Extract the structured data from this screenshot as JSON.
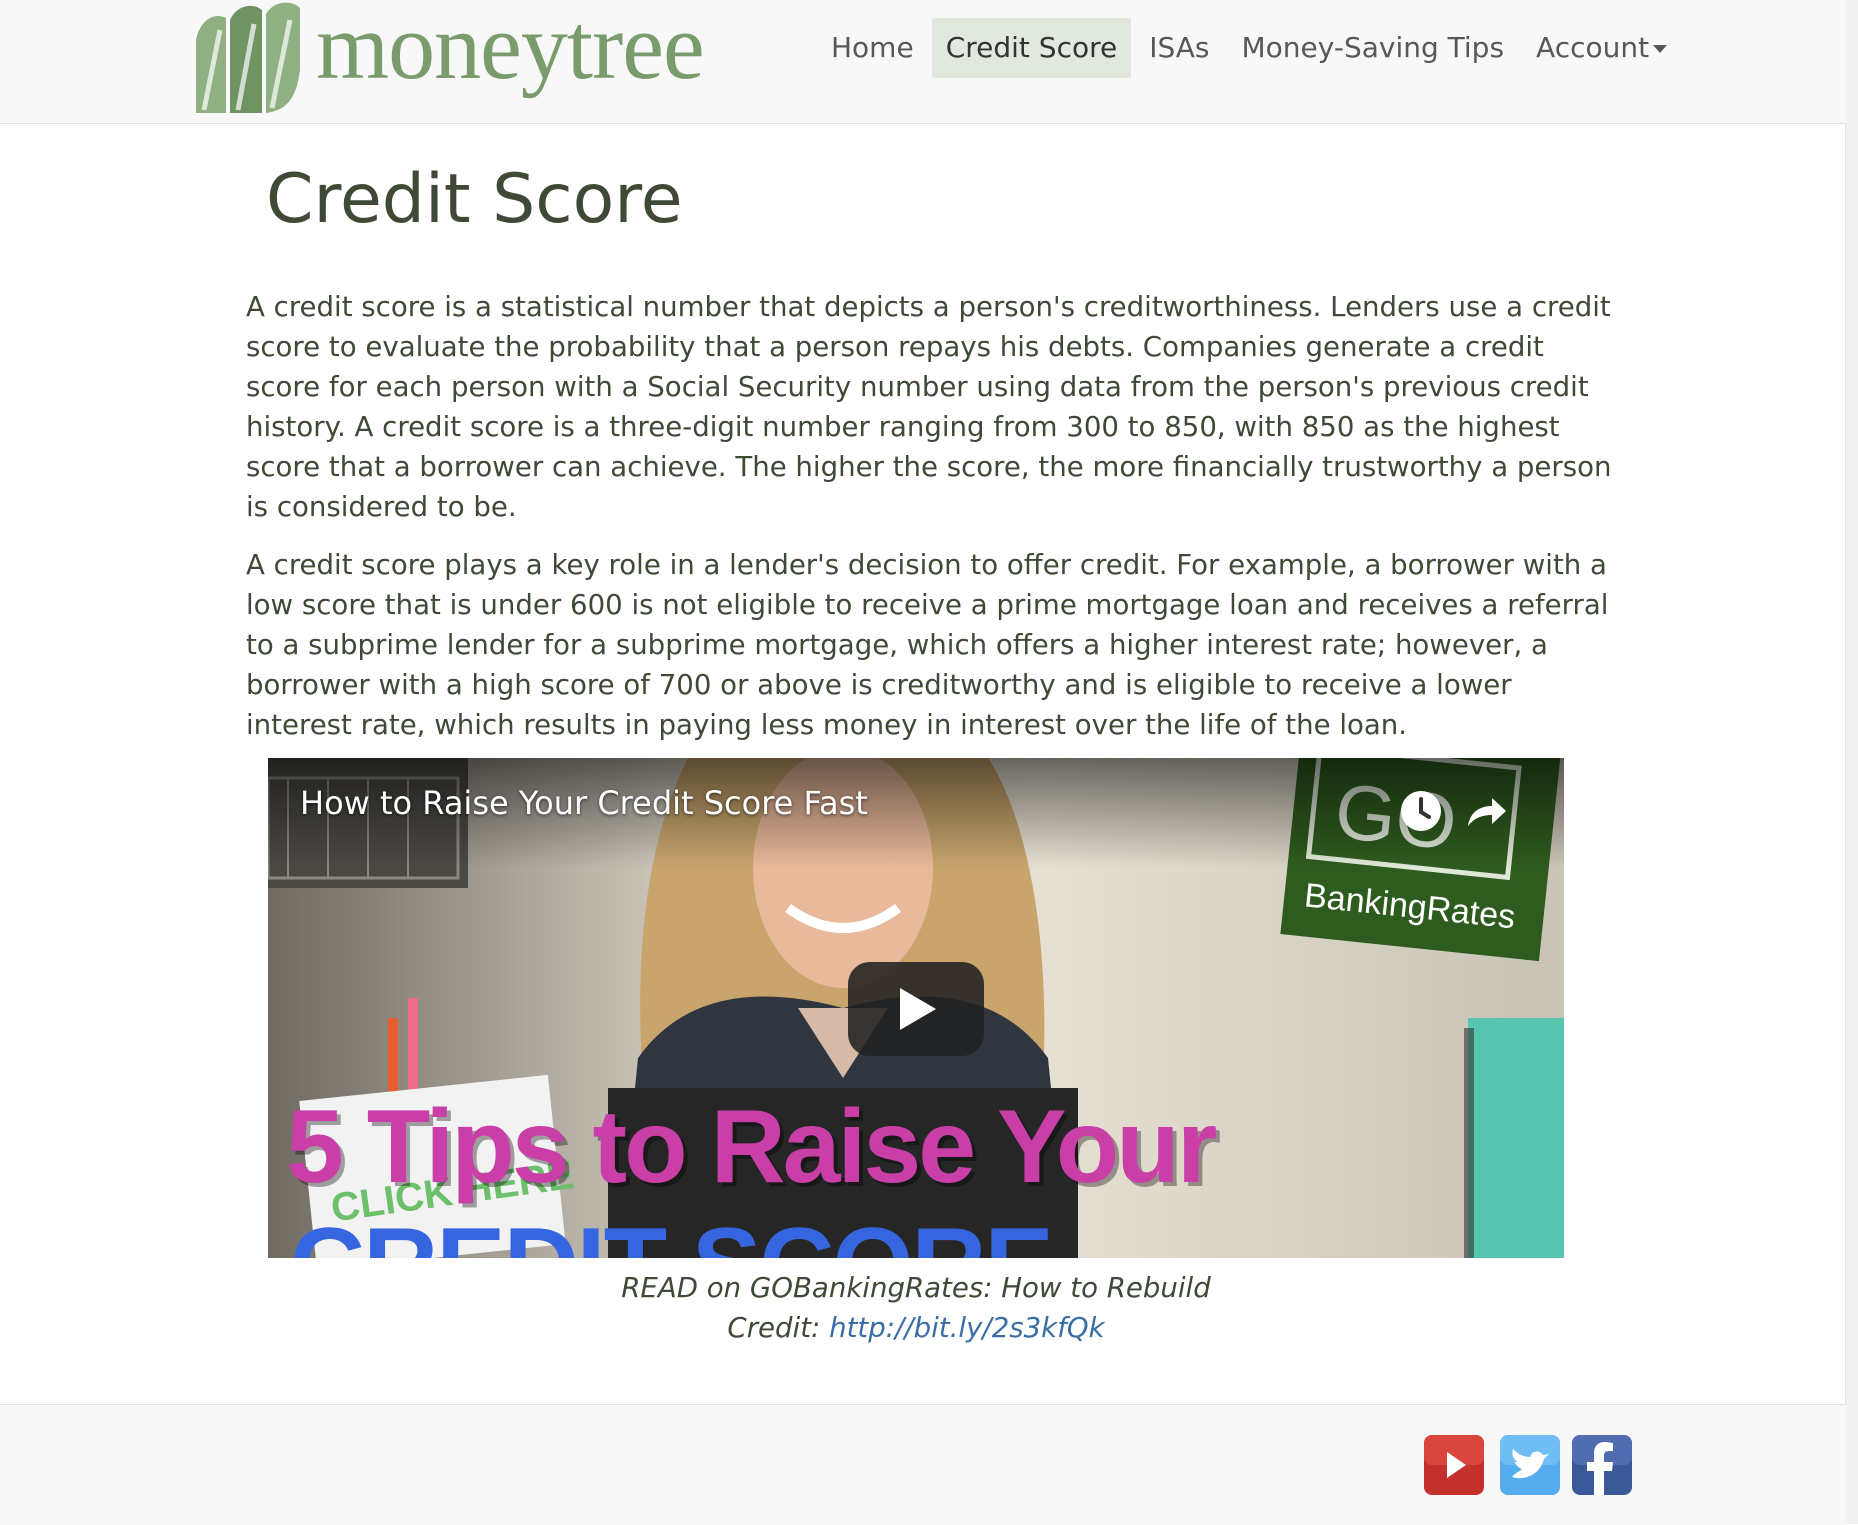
{
  "brand": {
    "name": "moneytree"
  },
  "nav": {
    "items": [
      {
        "label": "Home",
        "active": false
      },
      {
        "label": "Credit Score",
        "active": true
      },
      {
        "label": "ISAs",
        "active": false
      },
      {
        "label": "Money-Saving Tips",
        "active": false
      },
      {
        "label": "Account",
        "active": false,
        "dropdown": true
      }
    ]
  },
  "page": {
    "title": "Credit Score",
    "paragraphs": [
      "A credit score is a statistical number that depicts a person's creditworthiness. Lenders use a credit score to evaluate the probability that a person repays his debts. Companies generate a credit score for each person with a Social Security number using data from the person's previous credit history. A credit score is a three-digit number ranging from 300 to 850, with 850 as the highest score that a borrower can achieve. The higher the score, the more financially trustworthy a person is considered to be.",
      "A credit score plays a key role in a lender's decision to offer credit. For example, a borrower with a low score that is under 600 is not eligible to receive a prime mortgage loan and receives a referral to a subprime lender for a subprime mortgage, which offers a higher interest rate; however, a borrower with a high score of 700 or above is creditworthy and is eligible to receive a lower interest rate, which results in paying less money in interest over the life of the loan."
    ]
  },
  "video": {
    "title": "How to Raise Your Credit Score Fast",
    "overlay_line1": "5 Tips to Raise Your",
    "overlay_line2": "CREDIT SCORE",
    "logo_text_go": "GO",
    "logo_text_brand": "BankingRates",
    "sign_text": "CLICK HERE"
  },
  "caption": {
    "text_before": "READ on GOBankingRates: How to Rebuild",
    "text_line2": "Credit: ",
    "link_text": "http://bit.ly/2s3kfQk"
  },
  "footer": {
    "social": [
      {
        "icon": "youtube-icon",
        "color": "#c4302b"
      },
      {
        "icon": "twitter-icon",
        "color": "#55acee"
      },
      {
        "icon": "facebook-icon",
        "color": "#3b5998"
      }
    ]
  },
  "colors": {
    "brand_green": "#7a9c6d",
    "heading": "#3e4a36",
    "nav_active_bg": "#e1e8de",
    "link": "#3a6ea5"
  }
}
